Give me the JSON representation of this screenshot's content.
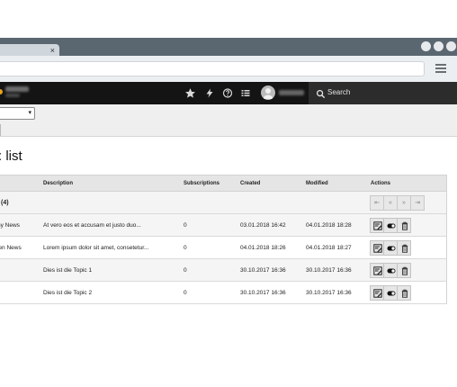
{
  "browser": {
    "tab_close": "×"
  },
  "nav": {
    "icons": [
      "star-icon",
      "bolt-icon",
      "help-icon",
      "list-icon",
      "user-icon"
    ],
    "search_label": "Search"
  },
  "toolbar": {
    "select_value": "",
    "select_chevron": "▾"
  },
  "page": {
    "title": ": list"
  },
  "table": {
    "headers": {
      "name": "",
      "description": "Description",
      "subscriptions": "Subscriptions",
      "created": "Created",
      "modified": "Modified",
      "actions": "Actions"
    },
    "group_label": "(4)",
    "pager": [
      "⇤",
      "«",
      "»",
      "⇥"
    ],
    "rows": [
      {
        "name": "ny News",
        "description": "At vero eos et accusam et justo duo...",
        "subscriptions": "0",
        "created": "03.01.2018 16:42",
        "modified": "04.01.2018 18:28"
      },
      {
        "name": "ien News",
        "description": "Lorem ipsum dolor sit amet, consetetur...",
        "subscriptions": "0",
        "created": "04.01.2018 18:26",
        "modified": "04.01.2018 18:27"
      },
      {
        "name": "",
        "description": "Dies ist die Topic 1",
        "subscriptions": "0",
        "created": "30.10.2017 16:36",
        "modified": "30.10.2017 16:36"
      },
      {
        "name": "",
        "description": "Dies ist die Topic 2",
        "subscriptions": "0",
        "created": "30.10.2017 16:36",
        "modified": "30.10.2017 16:36"
      }
    ],
    "row_actions": [
      "edit-icon",
      "toggle-icon",
      "delete-icon"
    ]
  },
  "colors": {
    "appbar": "#141414",
    "search_bg": "#2c2c2c",
    "tabstrip": "#5b6770",
    "brand_accent": "#e8a11c"
  }
}
